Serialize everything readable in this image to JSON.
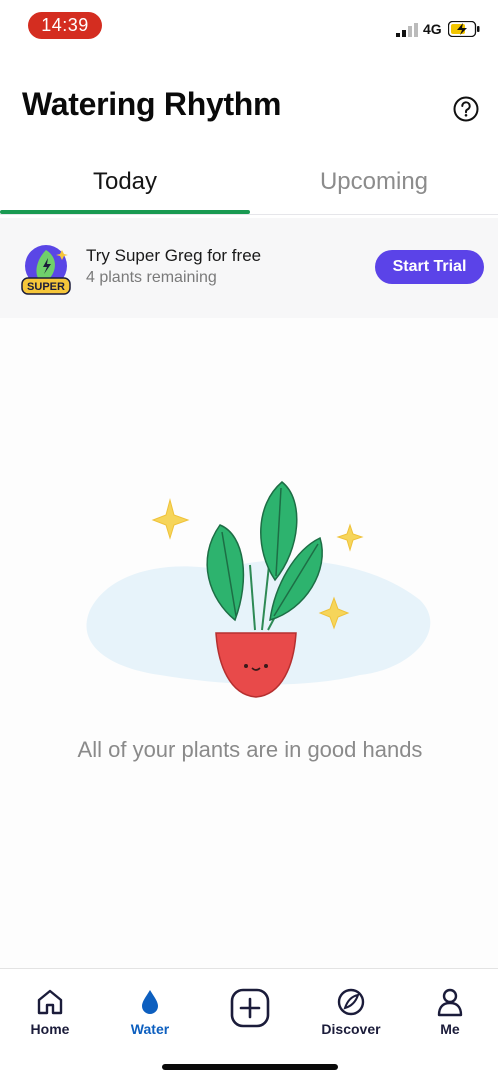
{
  "status_bar": {
    "time": "14:39",
    "network": "4G",
    "signal_icon": "signal-bars-icon",
    "battery_icon": "battery-charging-icon"
  },
  "header": {
    "title": "Watering Rhythm",
    "help_icon": "help-circle-icon"
  },
  "tabs": [
    {
      "label": "Today",
      "active": true
    },
    {
      "label": "Upcoming",
      "active": false
    }
  ],
  "promo": {
    "badge_icon": "super-badge-icon",
    "badge_text": "SUPER",
    "title": "Try Super Greg for free",
    "subtitle": "4 plants remaining",
    "button_label": "Start Trial"
  },
  "empty_state": {
    "illustration": "potted-plant-illustration",
    "message": "All of your plants are in good hands"
  },
  "bottom_nav": [
    {
      "label": "Home",
      "icon": "home-icon",
      "active": false
    },
    {
      "label": "Water",
      "icon": "water-drop-icon",
      "active": true
    },
    {
      "label": "",
      "icon": "add-square-icon",
      "active": false
    },
    {
      "label": "Discover",
      "icon": "discover-icon",
      "active": false
    },
    {
      "label": "Me",
      "icon": "user-icon",
      "active": false
    }
  ],
  "colors": {
    "accent_green": "#1a9a52",
    "trial_purple": "#5b43e8",
    "active_blue": "#0d5fbf",
    "time_pill_red": "#d42d20"
  }
}
